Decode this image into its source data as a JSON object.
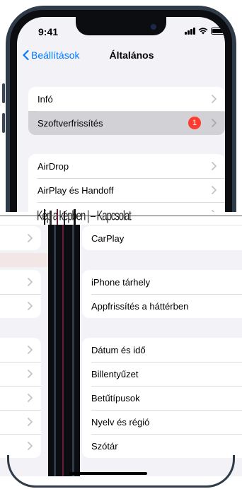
{
  "status_bar": {
    "time": "9:41"
  },
  "nav": {
    "back_label": "Beállítások",
    "title": "Általános"
  },
  "groups": {
    "top1": [
      {
        "label": "Infó"
      },
      {
        "label": "Szoftverfrissítés",
        "badge": "1"
      }
    ],
    "top2": [
      {
        "label": "AirDrop"
      },
      {
        "label": "AirPlay és Handoff"
      }
    ]
  },
  "glitch_text": "Kép a képben | – Kapcsolat",
  "lower": {
    "group1": [
      {
        "label": "CarPlay"
      }
    ],
    "group2": [
      {
        "label": "iPhone tárhely"
      },
      {
        "label": "Appfrissítés a háttérben"
      }
    ],
    "group3": [
      {
        "label": "Dátum és idő"
      },
      {
        "label": "Billentyűzet"
      },
      {
        "label": "Betűtípusok"
      },
      {
        "label": "Nyelv és régió"
      },
      {
        "label": "Szótár"
      }
    ]
  },
  "colors": {
    "accent": "#007aff",
    "badge": "#ff3b30",
    "background": "#f2f2f7",
    "selected_row": "#d1d1d6"
  },
  "icons": [
    "back-chevron-icon",
    "chevron-right-icon",
    "signal-icon",
    "wifi-icon",
    "battery-icon"
  ]
}
